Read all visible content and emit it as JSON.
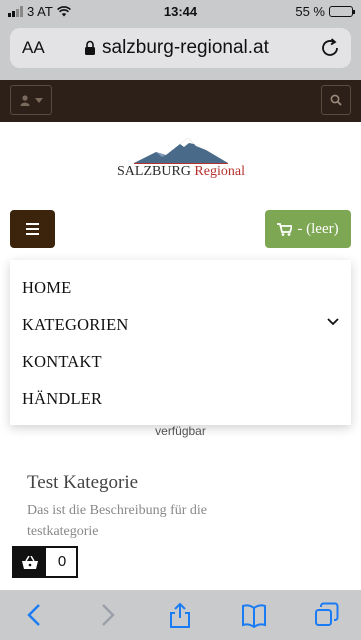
{
  "status_bar": {
    "carrier": "3 AT",
    "time": "13:44",
    "battery_percent": "55 %",
    "battery_level": 0.55
  },
  "address_bar": {
    "text_size_label": "AA",
    "url": "salzburg-regional.at"
  },
  "logo": {
    "brand_part1": "SALZBURG",
    "brand_part2": "Regional"
  },
  "cart": {
    "label": "- (leer)"
  },
  "menu": {
    "items": [
      {
        "label": "HOME"
      },
      {
        "label": "KATEGORIEN"
      },
      {
        "label": "KONTAKT"
      },
      {
        "label": "HÄNDLER"
      }
    ]
  },
  "content": {
    "availability_text": "verfügbar",
    "category_title": "Test Kategorie",
    "category_description": "Das ist die Beschreibung für die testkategorie"
  },
  "basket": {
    "count": "0"
  },
  "colors": {
    "topbar": "#2c2019",
    "menu_button": "#3b230c",
    "cart_button": "#7ea753",
    "safari_chrome": "#c9cacc",
    "ios_blue": "#1a7cf5"
  }
}
